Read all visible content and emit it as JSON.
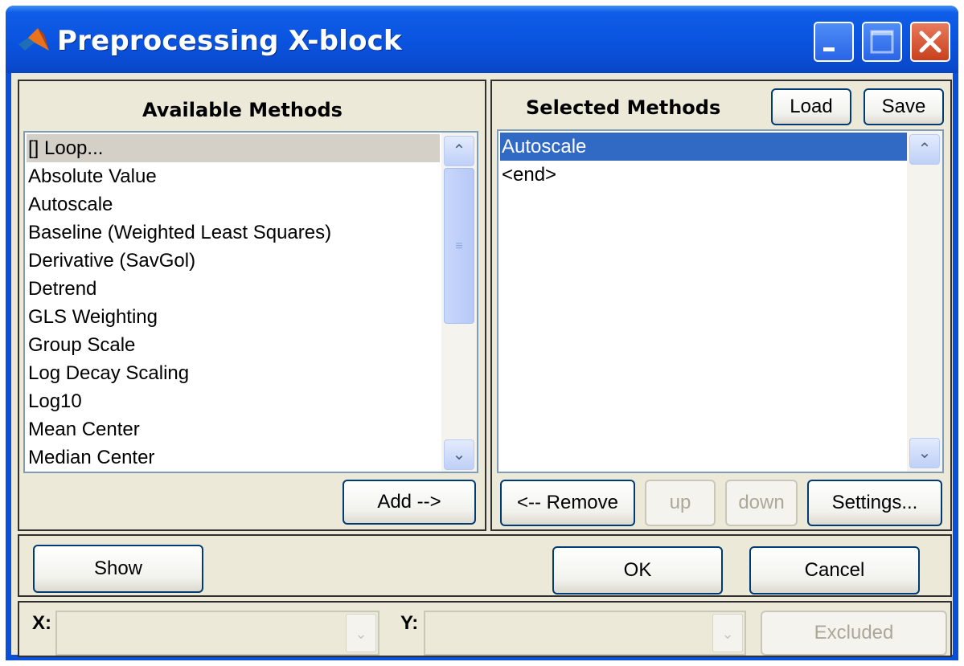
{
  "window": {
    "title": "Preprocessing X-block"
  },
  "available": {
    "heading": "Available Methods",
    "items": [
      "[] Loop...",
      "Absolute Value",
      "Autoscale",
      "Baseline (Weighted Least Squares)",
      "Derivative (SavGol)",
      "Detrend",
      "GLS Weighting",
      "Group Scale",
      "Log Decay Scaling",
      "Log10",
      "Mean Center",
      "Median Center"
    ],
    "add_label": "Add -->"
  },
  "selected": {
    "heading": "Selected Methods",
    "load_label": "Load",
    "save_label": "Save",
    "items": [
      "Autoscale",
      "<end>"
    ],
    "remove_label": "<-- Remove",
    "up_label": "up",
    "down_label": "down",
    "settings_label": "Settings..."
  },
  "actions": {
    "show_label": "Show",
    "ok_label": "OK",
    "cancel_label": "Cancel"
  },
  "footer": {
    "x_label": "X:",
    "y_label": "Y:",
    "excluded_label": "Excluded"
  },
  "colors": {
    "titlebar": "#0a53df",
    "selection": "#316ac5",
    "dialog_bg": "#ece9d8"
  },
  "icons": [
    "matlab-icon",
    "minimize-icon",
    "maximize-icon",
    "close-icon",
    "scroll-up-icon",
    "scroll-down-icon",
    "chevron-down-icon"
  ]
}
